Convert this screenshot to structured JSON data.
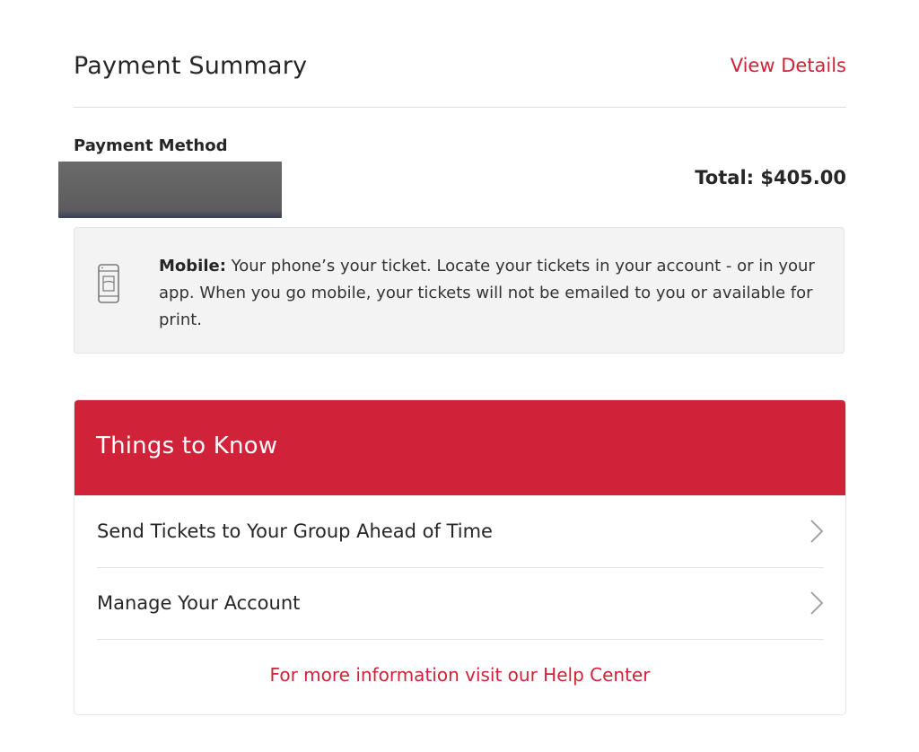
{
  "summary": {
    "title": "Payment Summary",
    "view_details": "View Details"
  },
  "payment": {
    "method_label": "Payment Method",
    "total": "Total: $405.00"
  },
  "notice": {
    "label": "Mobile:",
    "text": " Your phone’s your ticket. Locate your tickets in your account - or in your app. When you go mobile, your tickets will not be emailed to you or available for print.",
    "icon": "mobile-phone-icon"
  },
  "things_to_know": {
    "title": "Things to Know",
    "items": [
      {
        "label": "Send Tickets to Your Group Ahead of Time",
        "icon": "chevron-right-icon"
      },
      {
        "label": "Manage Your Account",
        "icon": "chevron-right-icon"
      }
    ],
    "help_link": "For more information visit our Help Center"
  },
  "colors": {
    "accent": "#d0233a",
    "text": "#262626",
    "notice_bg": "#f3f3f3"
  }
}
